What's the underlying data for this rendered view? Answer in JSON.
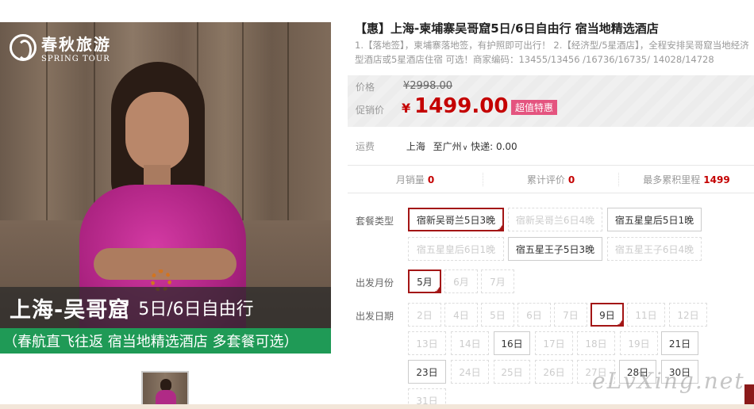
{
  "hero": {
    "logo_cn": "春秋旅游",
    "logo_en": "SPRING TOUR",
    "headline_main": "上海-吴哥窟",
    "headline_sub": "5日/6日自由行",
    "strip": "（春航直飞往返 宿当地精选酒店 多套餐可选）"
  },
  "product": {
    "title": "【惠】上海-柬埔寨吴哥窟5日/6日自由行 宿当地精选酒店",
    "description": "1.【落地签】，柬埔寨落地签，有护照即可出行！ 2.【经济型/5星酒店】，全程安排吴哥窟当地经济型酒店或5星酒店住宿 可选！商家编码：13455/13456 /16736/16735/ 14028/14728"
  },
  "price": {
    "original_label": "价格",
    "original_value": "¥2998.00",
    "promo_label": "促销价",
    "currency": "¥",
    "promo_value": "1499.00",
    "badge": "超值特惠"
  },
  "shipping": {
    "label": "运费",
    "from": "上海",
    "to": "至广州",
    "method": "快递: 0.00"
  },
  "stats": {
    "monthly_sales_label": "月销量",
    "monthly_sales": "0",
    "reviews_label": "累计评价",
    "reviews": "0",
    "mileage_label": "最多累积里程",
    "mileage": "1499"
  },
  "options": {
    "package_label": "套餐类型",
    "packages": [
      {
        "label": "宿新吴哥兰5日3晚",
        "state": "selected"
      },
      {
        "label": "宿新吴哥兰6日4晚",
        "state": "disabled"
      },
      {
        "label": "宿五星皇后5日1晚",
        "state": "enabled"
      },
      {
        "label": "宿五星皇后6日1晚",
        "state": "disabled"
      },
      {
        "label": "宿五星王子5日3晚",
        "state": "enabled"
      },
      {
        "label": "宿五星王子6日4晚",
        "state": "disabled"
      }
    ],
    "month_label": "出发月份",
    "months": [
      {
        "label": "5月",
        "state": "selected"
      },
      {
        "label": "6月",
        "state": "disabled"
      },
      {
        "label": "7月",
        "state": "disabled"
      }
    ],
    "date_label": "出发日期",
    "dates": [
      {
        "label": "2日",
        "state": "disabled"
      },
      {
        "label": "4日",
        "state": "disabled"
      },
      {
        "label": "5日",
        "state": "disabled"
      },
      {
        "label": "6日",
        "state": "disabled"
      },
      {
        "label": "7日",
        "state": "disabled"
      },
      {
        "label": "9日",
        "state": "selected"
      },
      {
        "label": "11日",
        "state": "disabled"
      },
      {
        "label": "12日",
        "state": "disabled"
      },
      {
        "label": "13日",
        "state": "disabled"
      },
      {
        "label": "14日",
        "state": "disabled"
      },
      {
        "label": "16日",
        "state": "enabled"
      },
      {
        "label": "17日",
        "state": "disabled"
      },
      {
        "label": "18日",
        "state": "disabled"
      },
      {
        "label": "19日",
        "state": "disabled"
      },
      {
        "label": "21日",
        "state": "enabled"
      },
      {
        "label": "23日",
        "state": "enabled"
      },
      {
        "label": "24日",
        "state": "disabled"
      },
      {
        "label": "25日",
        "state": "disabled"
      },
      {
        "label": "26日",
        "state": "disabled"
      },
      {
        "label": "27日",
        "state": "disabled"
      },
      {
        "label": "28日",
        "state": "enabled"
      },
      {
        "label": "30日",
        "state": "enabled"
      },
      {
        "label": "31日",
        "state": "disabled"
      }
    ]
  },
  "watermark": "eLvXing.net",
  "colors": {
    "accent_red": "#c40000",
    "selected_border": "#a31515",
    "badge_pink": "#e4547f",
    "strip_green": "#1f9a56"
  }
}
